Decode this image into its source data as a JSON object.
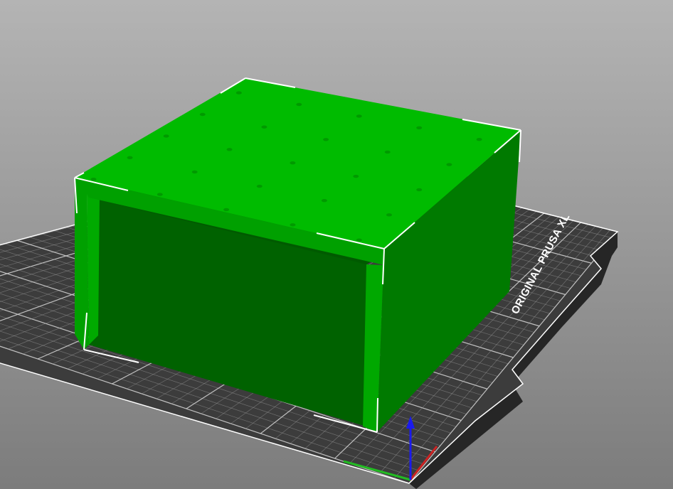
{
  "viewport": {
    "name": "3D Editor View",
    "background_top": "#b4b4b4",
    "background_bottom": "#7c7c7c"
  },
  "bed": {
    "label": "ORIGINAL PRUSA XL",
    "surface_color": "#3c3c3c",
    "shadow_color": "#262626",
    "grid_color": "#9a9a9a",
    "grid_major_color": "#d0d0d0",
    "edge_color": "#ffffff"
  },
  "model": {
    "state": "selected",
    "top_color": "#00bb00",
    "front_color": "#00a000",
    "right_color": "#007a00",
    "inner_color": "#006200",
    "hole_color": "#009a00",
    "selection_bracket_color": "#ffffff"
  },
  "axes": {
    "x_color": "#cc2222",
    "y_color": "#22bb22",
    "z_color": "#1a1aee"
  }
}
